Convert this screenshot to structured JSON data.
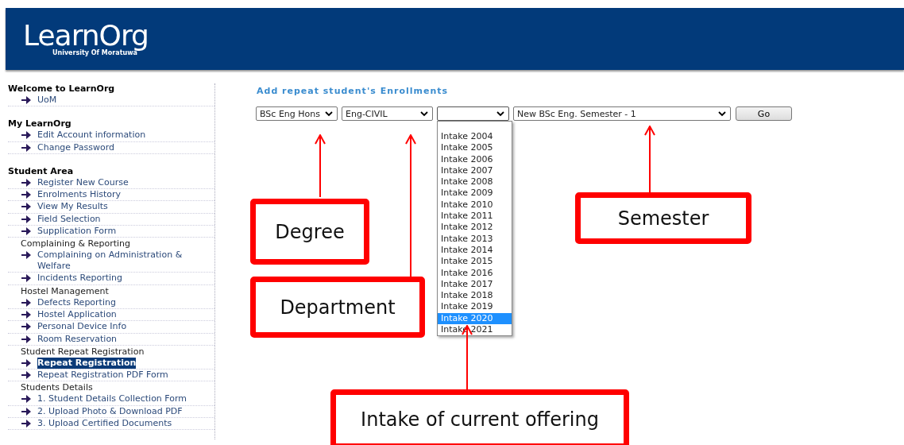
{
  "header": {
    "logo": "LearnOrg",
    "subtitle": "University Of Moratuwa"
  },
  "sidebar": {
    "sections": [
      {
        "heading": "Welcome to LearnOrg",
        "items": [
          {
            "kind": "link",
            "label": "UoM",
            "selected": false
          }
        ]
      },
      {
        "heading": "My LearnOrg",
        "items": [
          {
            "kind": "link",
            "label": "Edit Account information",
            "selected": false
          },
          {
            "kind": "link",
            "label": "Change Password",
            "selected": false
          }
        ]
      },
      {
        "heading": "Student Area",
        "items": [
          {
            "kind": "link",
            "label": "Register New Course",
            "selected": false
          },
          {
            "kind": "link",
            "label": "Enrolments History",
            "selected": false
          },
          {
            "kind": "link",
            "label": "View My Results",
            "selected": false
          },
          {
            "kind": "link",
            "label": "Field Selection",
            "selected": false
          },
          {
            "kind": "link",
            "label": "Supplication Form",
            "selected": false
          },
          {
            "kind": "group",
            "label": "Complaining & Reporting",
            "children": [
              {
                "label": "Complaining on Administration & Welfare",
                "selected": false
              },
              {
                "label": "Incidents Reporting",
                "selected": false
              }
            ]
          },
          {
            "kind": "group",
            "label": "Hostel Management",
            "children": [
              {
                "label": "Defects Reporting",
                "selected": false
              },
              {
                "label": "Hostel Application",
                "selected": false
              },
              {
                "label": "Personal Device Info",
                "selected": false
              },
              {
                "label": "Room Reservation",
                "selected": false
              }
            ]
          },
          {
            "kind": "group",
            "label": "Student Repeat Registration",
            "children": [
              {
                "label": "Repeat Registration",
                "selected": true
              },
              {
                "label": "Repeat Registration PDF Form",
                "selected": false
              }
            ]
          },
          {
            "kind": "group",
            "label": "Students Details",
            "children": [
              {
                "label": "1. Student Details Collection Form",
                "selected": false
              },
              {
                "label": "2. Upload Photo & Download PDF",
                "selected": false
              },
              {
                "label": "3. Upload Certified Documents",
                "selected": false
              }
            ]
          }
        ]
      }
    ]
  },
  "main": {
    "title": "Add repeat student's Enrollments",
    "selects": [
      {
        "value": "BSc Eng Hons",
        "expanded": false
      },
      {
        "value": "Eng-CIVIL",
        "expanded": false
      },
      {
        "expanded": true,
        "options": [
          {
            "label": "Intake 2004",
            "selected": false
          },
          {
            "label": "Intake 2005",
            "selected": false
          },
          {
            "label": "Intake 2006",
            "selected": false
          },
          {
            "label": "Intake 2007",
            "selected": false
          },
          {
            "label": "Intake 2008",
            "selected": false
          },
          {
            "label": "Intake 2009",
            "selected": false
          },
          {
            "label": "Intake 2010",
            "selected": false
          },
          {
            "label": "Intake 2011",
            "selected": false
          },
          {
            "label": "Intake 2012",
            "selected": false
          },
          {
            "label": "Intake 2013",
            "selected": false
          },
          {
            "label": "Intake 2014",
            "selected": false
          },
          {
            "label": "Intake 2015",
            "selected": false
          },
          {
            "label": "Intake 2016",
            "selected": false
          },
          {
            "label": "Intake 2017",
            "selected": false
          },
          {
            "label": "Intake 2018",
            "selected": false
          },
          {
            "label": "Intake 2019",
            "selected": false
          },
          {
            "label": "Intake 2020",
            "selected": true
          },
          {
            "label": "Intake 2021",
            "selected": false
          }
        ]
      },
      {
        "value": "New BSc Eng. Semester - 1",
        "expanded": false
      }
    ],
    "go_button": "Go"
  },
  "annotations": [
    {
      "label": "Degree"
    },
    {
      "label": "Department"
    },
    {
      "label": "Semester"
    },
    {
      "label": "Intake of current offering"
    }
  ]
}
